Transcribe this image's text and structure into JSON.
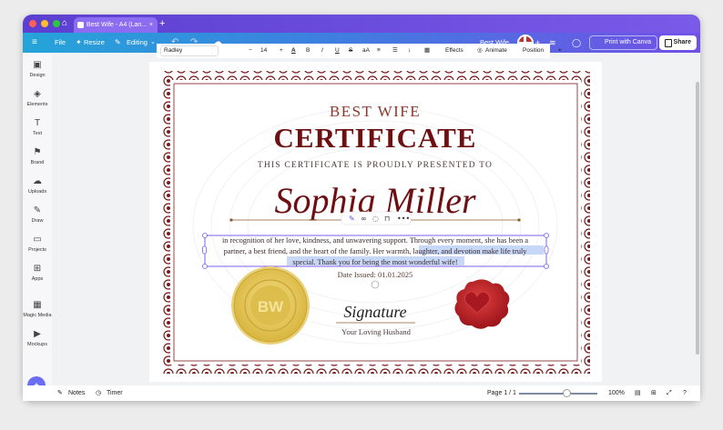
{
  "browser": {
    "tab_title": "Best Wife - A4 (Lan...",
    "tab_close": "×",
    "new_tab": "+",
    "traffic_light_colors": [
      "#ff5f57",
      "#febc2e",
      "#28c840"
    ],
    "accent": "#7a5ae8"
  },
  "menubar": {
    "menu_icon": "≡",
    "file": "File",
    "resize": "Resize",
    "editing": "Editing",
    "undo": "↶",
    "redo": "↷",
    "cloud": "☁",
    "design_title": "Best Wife",
    "add_collaborator": "+",
    "stats_icon": "≋",
    "comment_icon": "◯",
    "print": "Print with Canva",
    "share": "Share"
  },
  "sidebar": {
    "items": [
      {
        "label": "Design",
        "icon": "▣"
      },
      {
        "label": "Elements",
        "icon": "◈"
      },
      {
        "label": "Text",
        "icon": "T"
      },
      {
        "label": "Brand",
        "icon": "⚑"
      },
      {
        "label": "Uploads",
        "icon": "☁"
      },
      {
        "label": "Draw",
        "icon": "✎"
      },
      {
        "label": "Projects",
        "icon": "▭"
      },
      {
        "label": "Apps",
        "icon": "⊞"
      },
      {
        "label": "Magic Media",
        "icon": "▦"
      },
      {
        "label": "Mockups",
        "icon": "▶"
      }
    ]
  },
  "toolbar": {
    "font": "Radley",
    "minus": "−",
    "font_size": "14",
    "plus": "+",
    "text_color": "A",
    "bold": "B",
    "italic": "I",
    "underline": "U",
    "strikethrough": "S",
    "case": "aA",
    "align": "≡",
    "list": "☰",
    "spacing": "↕",
    "effects": "Effects",
    "animate": "Animate",
    "position": "Position",
    "paint": "⌖"
  },
  "certificate": {
    "heading": "BEST WIFE",
    "title": "CERTIFICATE",
    "subtitle": "THIS CERTIFICATE IS PROUDLY PRESENTED TO",
    "name": "Sophia Miller",
    "body_line1": "in recognition of her love, kindness, and unwavering support. Through every moment, she has been a",
    "body_line2a": "partner, a best friend, and the heart of the family. Her warmth, ",
    "body_line2b": "laughter, and devotion make life truly",
    "body_line3a": "special. Thank you for being the most wonderful wife!",
    "date": "Date Issued: 01.01.2025",
    "seal_initials": "BW",
    "signature": "Signature",
    "signer": "Your Loving Husband",
    "colors": {
      "maroon": "#7a1a1a",
      "gold": "#e6c650",
      "seal": "#c9232c",
      "selection": "#c7d7f8"
    }
  },
  "bottombar": {
    "notes": "Notes",
    "timer": "Timer",
    "page": "Page 1 / 1",
    "zoom_value": 100,
    "zoom": "100%"
  }
}
